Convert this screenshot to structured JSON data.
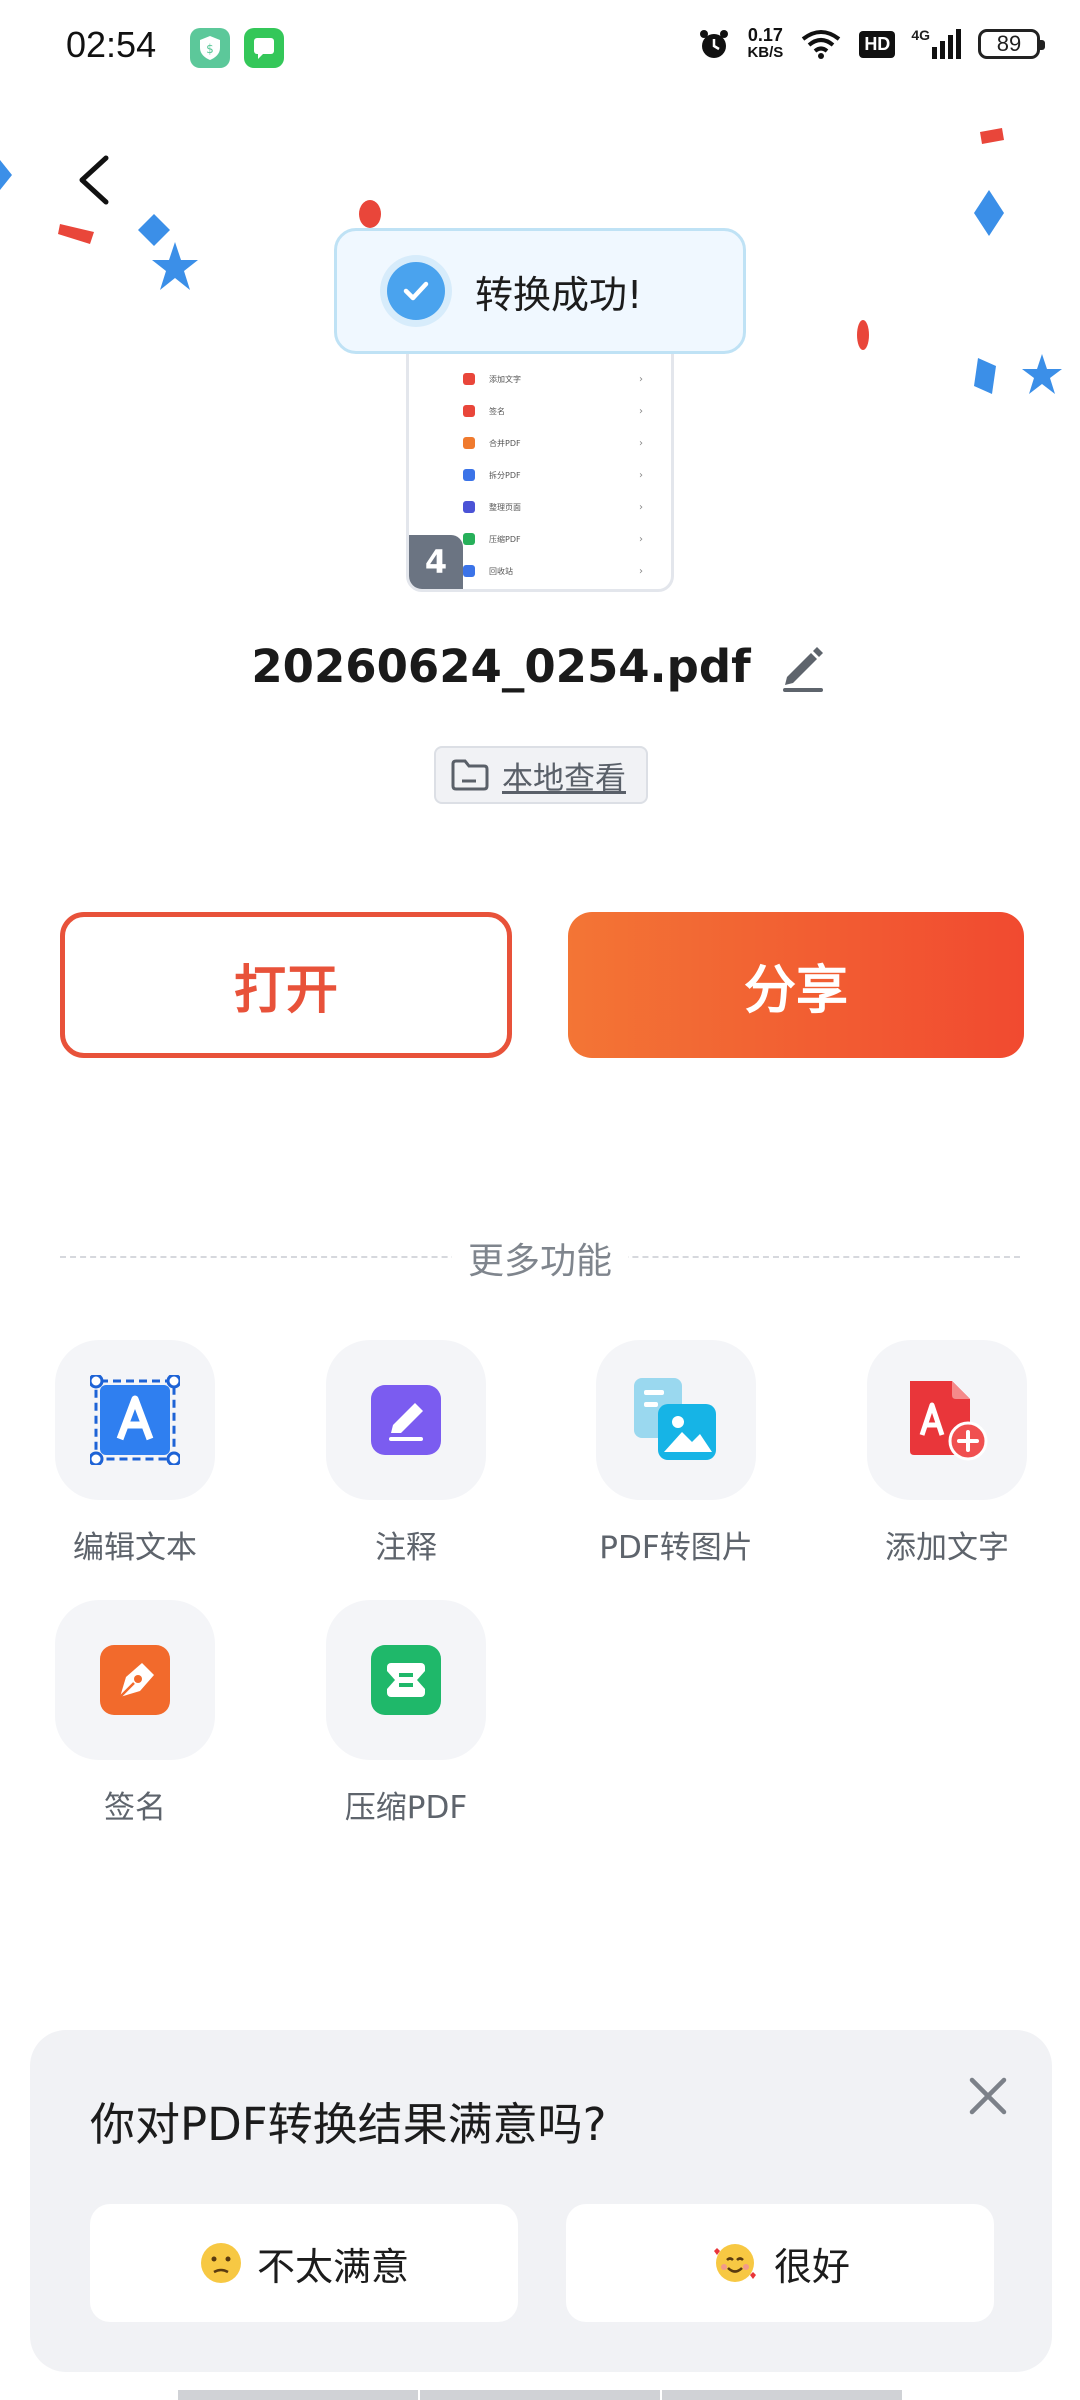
{
  "status_bar": {
    "time": "02:54",
    "net_speed_value": "0.17",
    "net_speed_unit": "KB/S",
    "hd_label": "HD",
    "network_label": "4G",
    "battery": "89"
  },
  "toast": {
    "text": "转换成功!"
  },
  "thumbnail": {
    "items": [
      "添加文字",
      "签名",
      "合并PDF",
      "拆分PDF",
      "整理页面",
      "压缩PDF",
      "回收站"
    ],
    "page_count": "4"
  },
  "file": {
    "name": "20260624_0254.pdf"
  },
  "local_view": {
    "label": "本地查看"
  },
  "actions": {
    "open": "打开",
    "share": "分享"
  },
  "more": {
    "title": "更多功能",
    "items": [
      {
        "label": "编辑文本",
        "icon": "edit-text-icon"
      },
      {
        "label": "注释",
        "icon": "annotate-icon"
      },
      {
        "label": "PDF转图片",
        "icon": "pdf-to-image-icon"
      },
      {
        "label": "添加文字",
        "icon": "add-text-icon"
      },
      {
        "label": "签名",
        "icon": "signature-icon"
      },
      {
        "label": "压缩PDF",
        "icon": "compress-pdf-icon"
      }
    ]
  },
  "feedback": {
    "question": "你对PDF转换结果满意吗?",
    "negative": "不太满意",
    "positive": "很好"
  },
  "colors": {
    "accent": "#f14a30",
    "success_blue": "#4aa3ee"
  }
}
